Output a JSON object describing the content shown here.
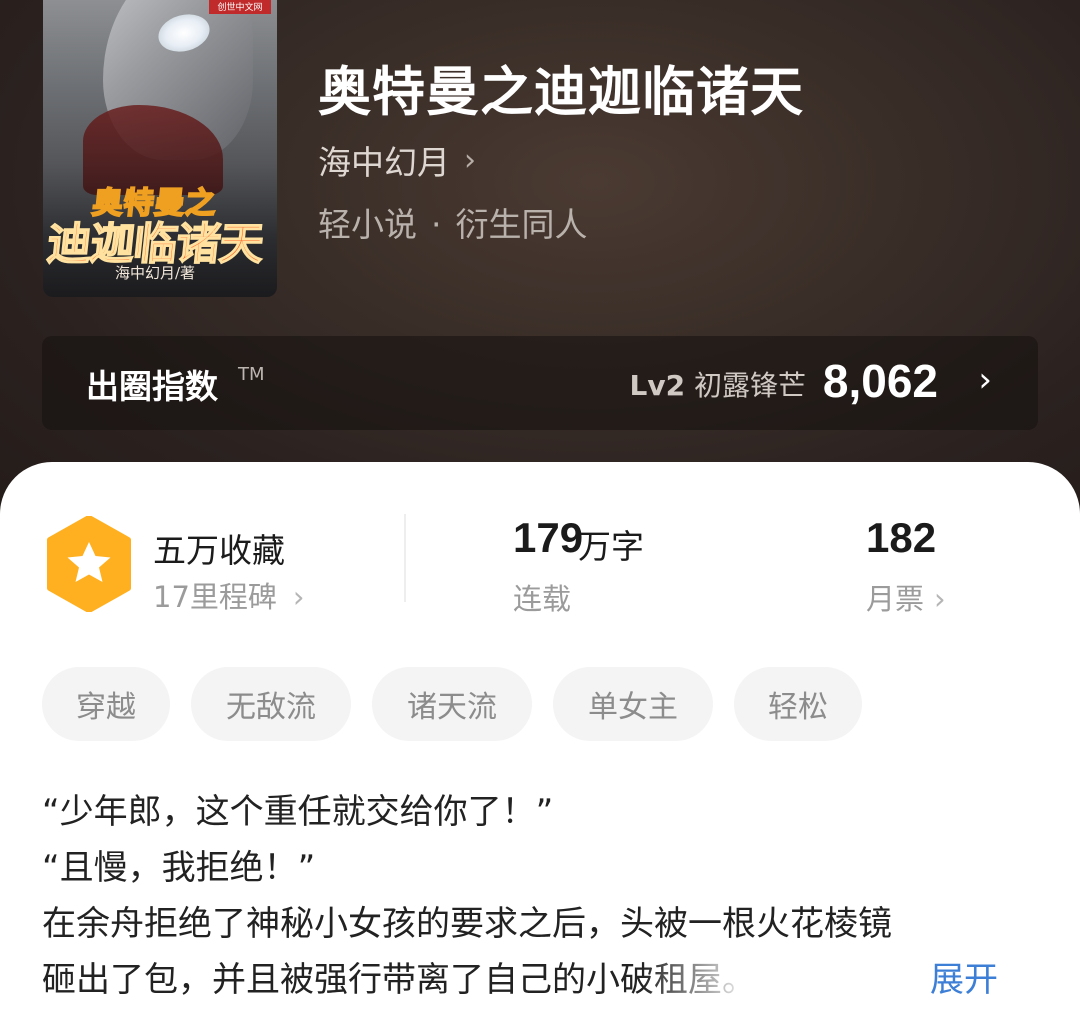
{
  "book": {
    "title": "奥特曼之迪迦临诸天",
    "author": "海中幻月",
    "author_chevron": "›",
    "category": "轻小说",
    "category_separator": "·",
    "subcategory": "衍生同人",
    "cover": {
      "publisher_badge": "创世中文网",
      "title_line1": "奥特曼之",
      "title_line2": "迪迦临诸天",
      "author_credit": "海中幻月/著"
    }
  },
  "index": {
    "label": "出圈指数",
    "trademark": "TM",
    "level": "Lv2",
    "level_name": "初露锋芒",
    "value": "8,062",
    "chevron": "›"
  },
  "stats": {
    "collection": {
      "label": "五万收藏",
      "milestone": "17里程碑",
      "chevron": "›"
    },
    "words": {
      "number": "179",
      "unit": "万字",
      "status": "连载"
    },
    "monthly_votes": {
      "number": "182",
      "label": "月票",
      "chevron": "›"
    }
  },
  "tags": [
    "穿越",
    "无敌流",
    "诸天流",
    "单女主",
    "轻松"
  ],
  "description": {
    "lines": [
      "“少年郎，这个重任就交给你了！”",
      "“且慢，我拒绝！”",
      "在余舟拒绝了神秘小女孩的要求之后，头被一根火花棱镜",
      "砸出了包，并且被强行带离了自己的小破租屋。"
    ],
    "expand_label": "展开"
  },
  "colors": {
    "header_bg": "#2a211d",
    "badge_orange": "#ffb020",
    "link_blue": "#3d7fd6",
    "tag_bg": "#f4f4f4"
  }
}
